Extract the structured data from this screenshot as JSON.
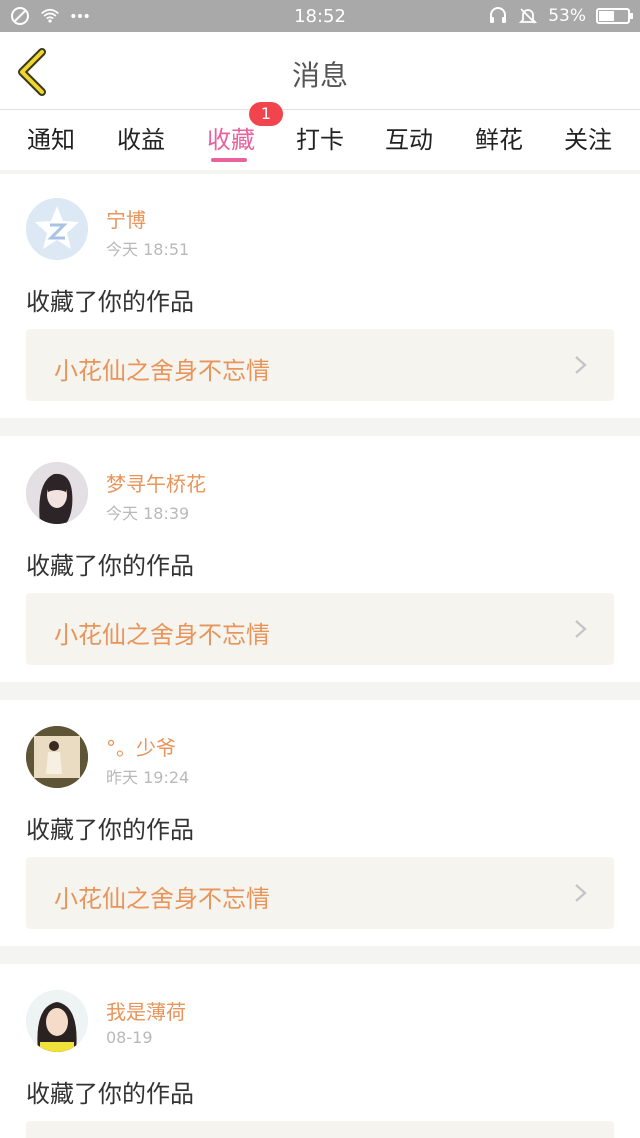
{
  "status_bar": {
    "time": "18:52",
    "battery_pct": "53%",
    "battery_level": 0.53,
    "icons_left": [
      "block-icon",
      "wifi-icon",
      "more-dots-icon"
    ],
    "icons_right": [
      "headset-icon",
      "mute-bell-icon"
    ]
  },
  "header": {
    "title": "消息",
    "back_icon": "chevron-left-icon"
  },
  "tabs": [
    {
      "label": "通知"
    },
    {
      "label": "收益"
    },
    {
      "label": "收藏",
      "active": true,
      "badge": "1"
    },
    {
      "label": "打卡"
    },
    {
      "label": "互动"
    },
    {
      "label": "鲜花"
    },
    {
      "label": "关注"
    }
  ],
  "colors": {
    "accent": "#e9629d",
    "name": "#e8945a",
    "badge": "#f2444c"
  },
  "items": [
    {
      "name": "宁博",
      "time": "今天 18:51",
      "action": "收藏了你的作品",
      "work": "小花仙之舍身不忘情"
    },
    {
      "name": "梦寻午桥花",
      "time": "今天 18:39",
      "action": "收藏了你的作品",
      "work": "小花仙之舍身不忘情"
    },
    {
      "name": "°。少爷",
      "time": "昨天 19:24",
      "action": "收藏了你的作品",
      "work": "小花仙之舍身不忘情"
    },
    {
      "name": "我是薄荷",
      "time": "08-19",
      "action": "收藏了你的作品",
      "work": ""
    }
  ]
}
